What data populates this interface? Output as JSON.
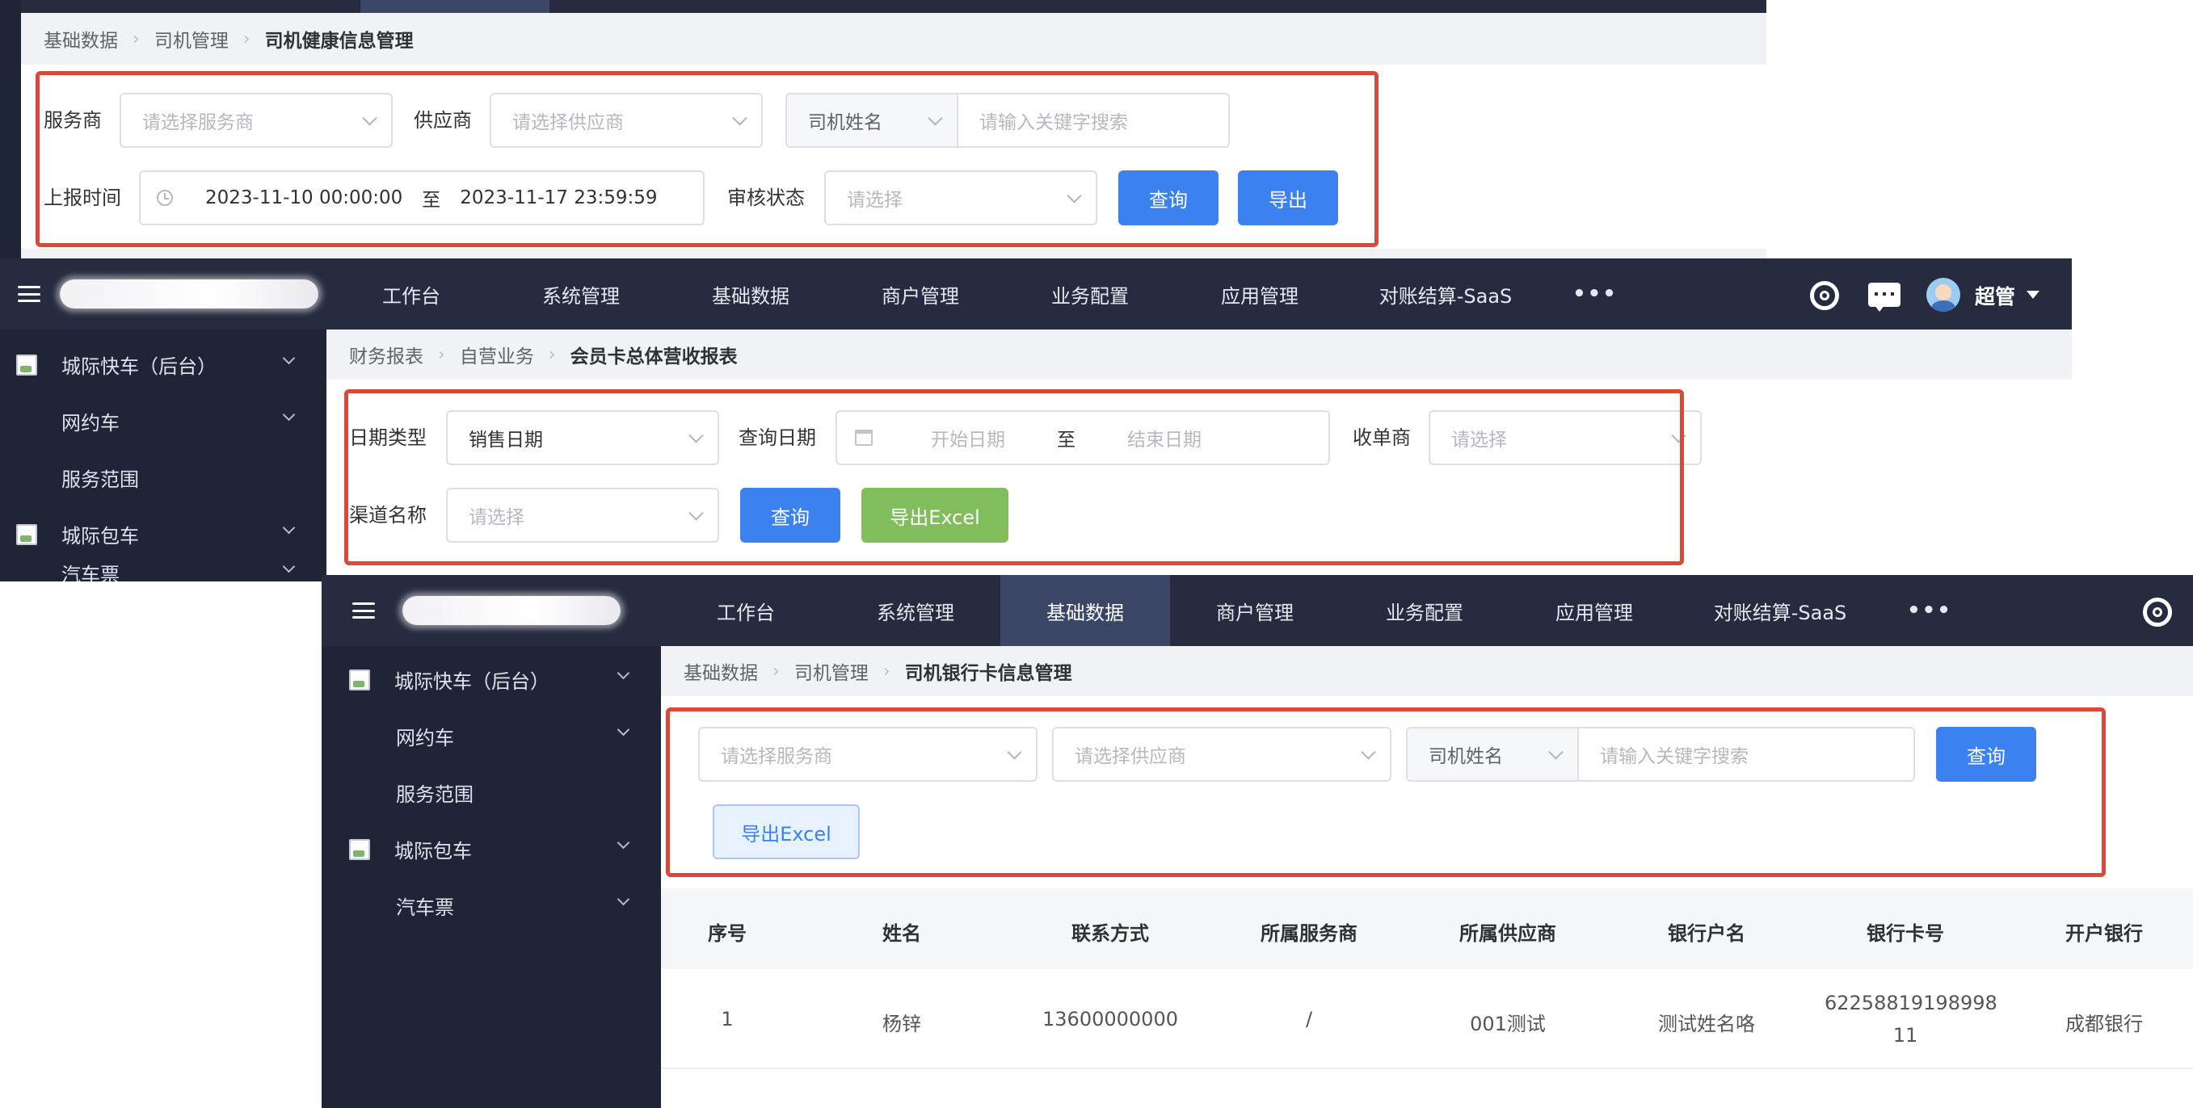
{
  "panel1": {
    "breadcrumb": [
      "基础数据",
      "司机管理",
      "司机健康信息管理"
    ],
    "labels": {
      "provider": "服务商",
      "supplier": "供应商",
      "report_time": "上报时间",
      "audit_status": "审核状态"
    },
    "provider_placeholder": "请选择服务商",
    "supplier_placeholder": "请选择供应商",
    "search_type": "司机姓名",
    "keyword_placeholder": "请输入关键字搜索",
    "start_time": "2023-11-10 00:00:00",
    "range_sep": "至",
    "end_time": "2023-11-17 23:59:59",
    "audit_placeholder": "请选择",
    "query_button": "查询",
    "export_button": "导出"
  },
  "panel2": {
    "nav": [
      "工作台",
      "系统管理",
      "基础数据",
      "商户管理",
      "业务配置",
      "应用管理",
      "对账结算-SaaS"
    ],
    "more": "•••",
    "user": "超管",
    "sidebar": [
      "城际快车（后台）",
      "网约车",
      "服务范围",
      "城际包车",
      "汽车票"
    ],
    "breadcrumb": [
      "财务报表",
      "自营业务",
      "会员卡总体营收报表"
    ],
    "labels": {
      "date_type": "日期类型",
      "query_date": "查询日期",
      "acquirer": "收单商",
      "channel": "渠道名称"
    },
    "date_type_value": "销售日期",
    "start_placeholder": "开始日期",
    "range_sep": "至",
    "end_placeholder": "结束日期",
    "acquirer_placeholder": "请选择",
    "channel_placeholder": "请选择",
    "query_button": "查询",
    "export_button": "导出Excel"
  },
  "panel3": {
    "nav": [
      "工作台",
      "系统管理",
      "基础数据",
      "商户管理",
      "业务配置",
      "应用管理",
      "对账结算-SaaS"
    ],
    "more": "•••",
    "sidebar": [
      "城际快车（后台）",
      "网约车",
      "服务范围",
      "城际包车",
      "汽车票"
    ],
    "breadcrumb": [
      "基础数据",
      "司机管理",
      "司机银行卡信息管理"
    ],
    "provider_placeholder": "请选择服务商",
    "supplier_placeholder": "请选择供应商",
    "search_type": "司机姓名",
    "keyword_placeholder": "请输入关键字搜索",
    "query_button": "查询",
    "export_button": "导出Excel",
    "table": {
      "headers": [
        "序号",
        "姓名",
        "联系方式",
        "所属服务商",
        "所属供应商",
        "银行户名",
        "银行卡号",
        "开户银行"
      ],
      "rows": [
        {
          "index": "1",
          "name": "杨锌",
          "phone": "13600000000",
          "provider": "/",
          "supplier": "001测试",
          "account_name": "测试姓名咯",
          "card_no_line1": "62258819198998",
          "card_no_line2": "11",
          "bank": "成都银行"
        }
      ]
    }
  },
  "colors": {
    "nav_bg": "#262b3f",
    "sidebar_bg": "#1f2437",
    "primary": "#3b82f0",
    "excel_green": "#82bd5b",
    "highlight_red": "#d9493a"
  }
}
